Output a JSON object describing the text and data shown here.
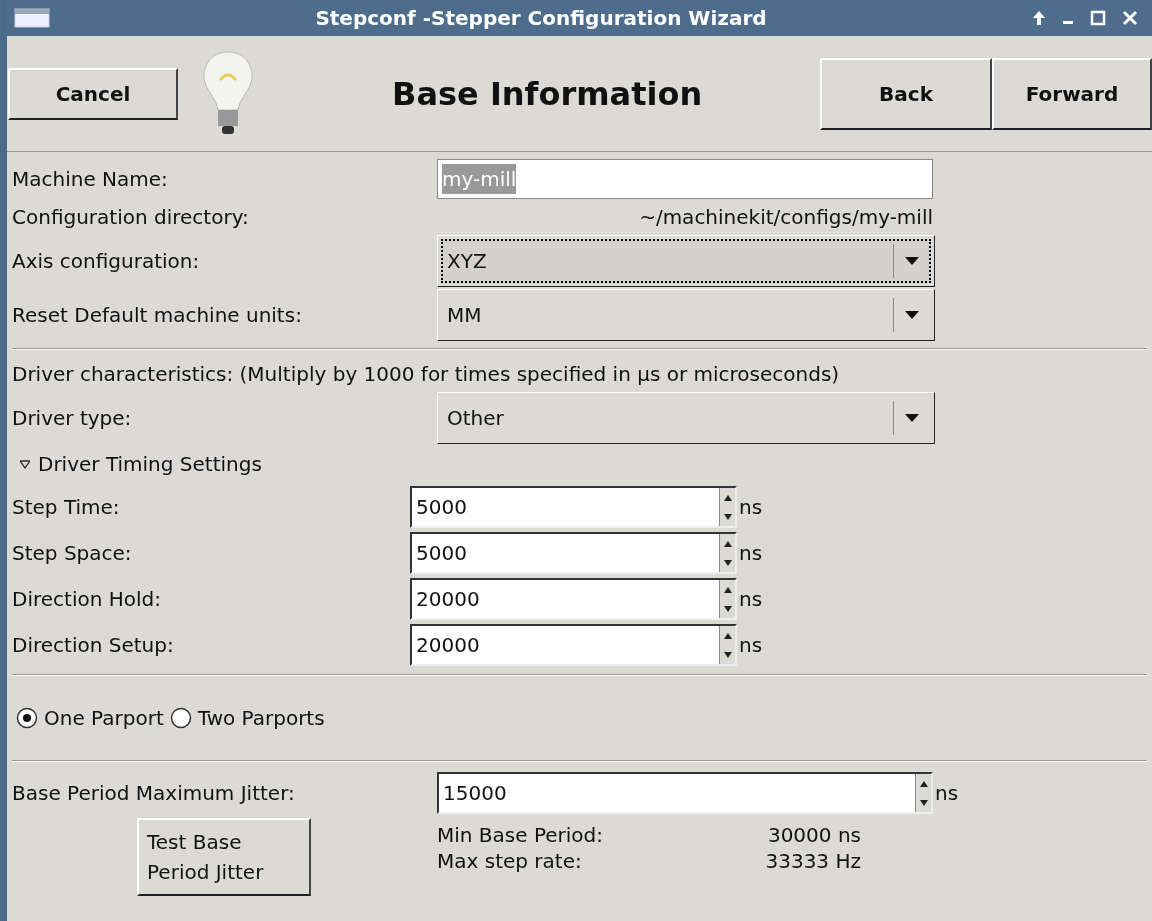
{
  "window": {
    "title": "Stepconf -Stepper Configuration Wizard"
  },
  "toolbar": {
    "cancel": "Cancel",
    "heading": "Base Information",
    "back": "Back",
    "forward": "Forward"
  },
  "machine": [
    {
      "kind": "entry",
      "label": "Machine Name:",
      "value": "my-mill",
      "selected": true
    },
    {
      "kind": "text",
      "label": "Configuration directory:",
      "value": "~/machinekit/configs/my-mill"
    },
    {
      "kind": "combo",
      "label": "Axis configuration:",
      "value": "XYZ",
      "focused": true
    },
    {
      "kind": "combo",
      "label": "Reset Default machine units:",
      "value": "MM",
      "focused": false
    }
  ],
  "driver": {
    "note": "Driver characteristics: (Multiply by 1000 for times specified in µs or microseconds)",
    "type_label": "Driver type:",
    "type_value": "Other",
    "timing": {
      "label": "Driver Timing Settings",
      "expanded": true
    }
  },
  "timing_rows": [
    {
      "label": "Step Time:",
      "value": "5000",
      "unit": "ns"
    },
    {
      "label": "Step Space:",
      "value": "5000",
      "unit": "ns"
    },
    {
      "label": "Direction Hold:",
      "value": "20000",
      "unit": "ns"
    },
    {
      "label": "Direction Setup:",
      "value": "20000",
      "unit": "ns"
    }
  ],
  "parports": [
    {
      "label": "One Parport",
      "selected": true
    },
    {
      "label": "Two Parports",
      "selected": false
    }
  ],
  "jitter": {
    "label": "Base Period Maximum Jitter:",
    "value": "15000",
    "unit": "ns",
    "test_button": "Test Base Period Jitter"
  },
  "results": [
    {
      "label": "Min Base Period:",
      "value": "30000 ns"
    },
    {
      "label": "Max step rate:",
      "value": "33333 Hz"
    }
  ]
}
